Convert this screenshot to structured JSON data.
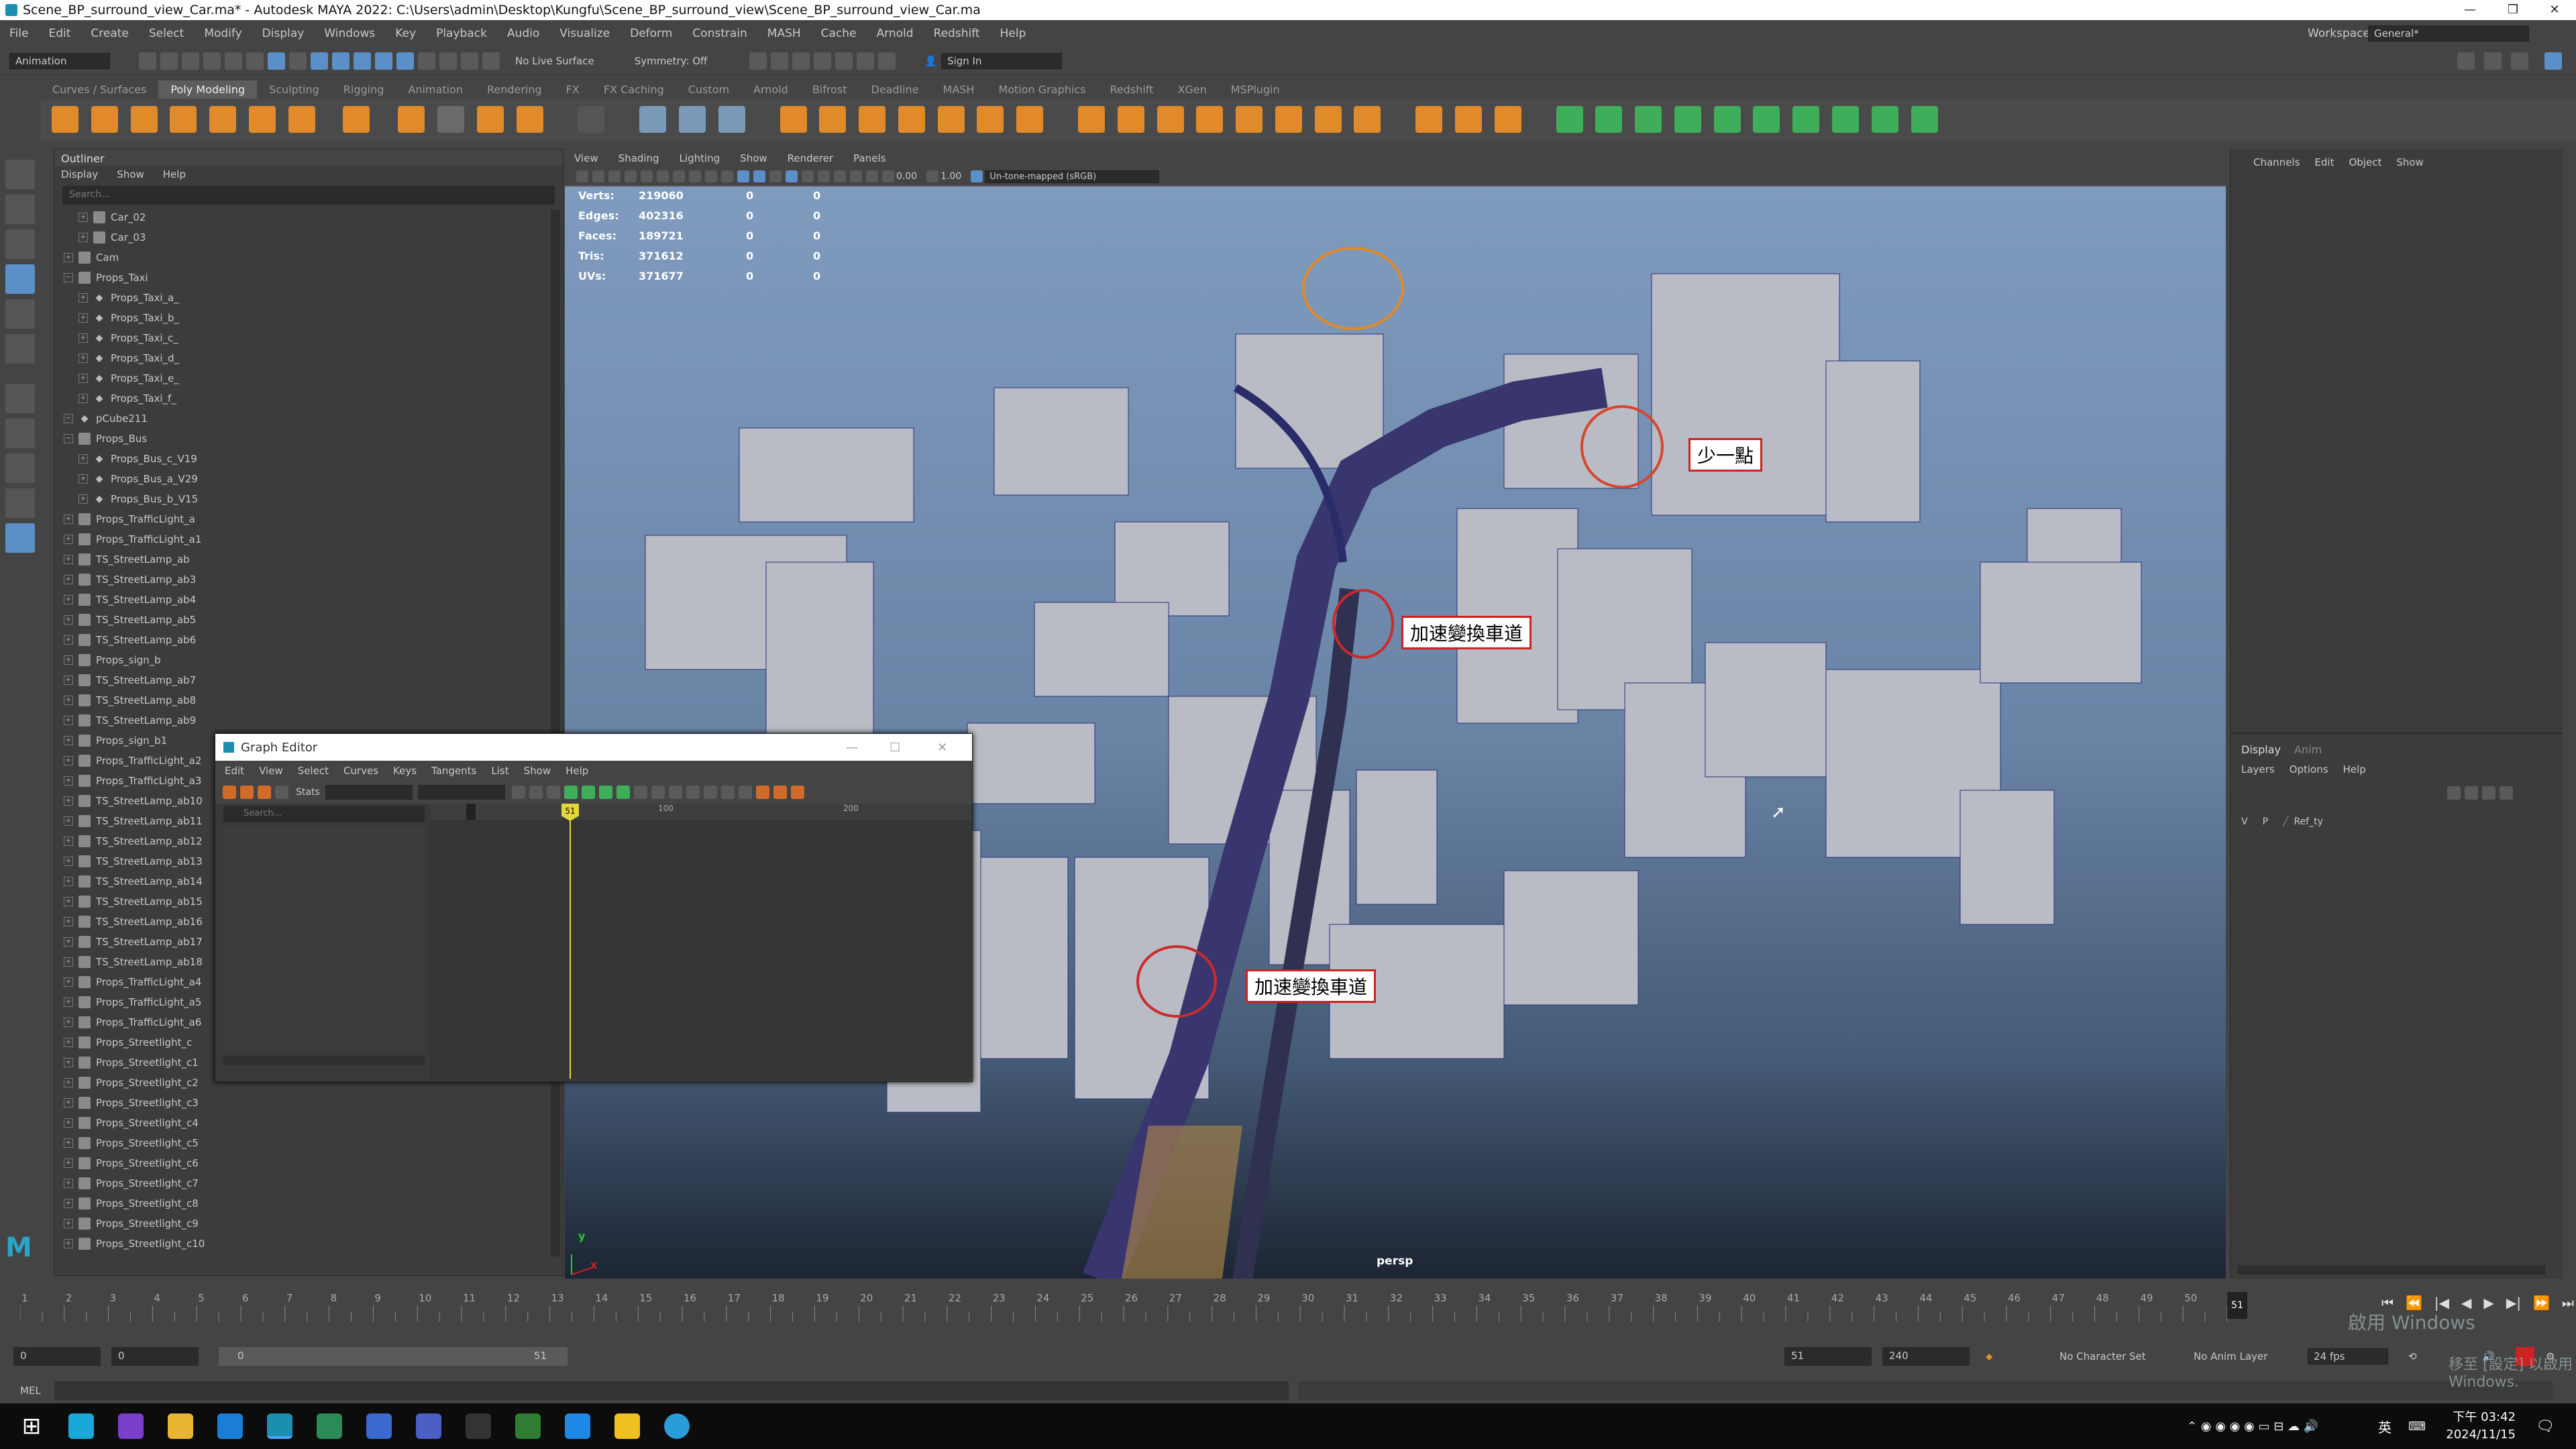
{
  "window": {
    "title": "Scene_BP_surround_view_Car.ma* - Autodesk MAYA 2022: C:\\Users\\admin\\Desktop\\Kungfu\\Scene_BP_surround_view\\Scene_BP_surround_view_Car.ma",
    "minimize": "—",
    "restore": "❐",
    "close": "✕"
  },
  "menubar": {
    "items": [
      "File",
      "Edit",
      "Create",
      "Select",
      "Modify",
      "Display",
      "Windows",
      "Key",
      "Playback",
      "Audio",
      "Visualize",
      "Deform",
      "Constrain",
      "MASH",
      "Cache",
      "Arnold",
      "Redshift",
      "Help"
    ],
    "workspace_label": "Workspace :",
    "workspace_value": "General*"
  },
  "statusline": {
    "menuset": "Animation",
    "live_surface": "No Live Surface",
    "symmetry": "Symmetry: Off",
    "sign_in": "Sign In"
  },
  "shelf": {
    "tabs": [
      "Curves / Surfaces",
      "Poly Modeling",
      "Sculpting",
      "Rigging",
      "Animation",
      "Rendering",
      "FX",
      "FX Caching",
      "Custom",
      "Arnold",
      "Bifrost",
      "Deadline",
      "MASH",
      "Motion Graphics",
      "Redshift",
      "XGen",
      "MSPlugin"
    ],
    "active_tab": "Poly Modeling"
  },
  "outliner": {
    "title": "Outliner",
    "menu": [
      "Display",
      "Show",
      "Help"
    ],
    "search_placeholder": "Search...",
    "items": [
      {
        "label": "Car_02",
        "indent": 1,
        "exp": true,
        "mesh": false
      },
      {
        "label": "Car_03",
        "indent": 1,
        "exp": true,
        "mesh": false
      },
      {
        "label": "Cam",
        "indent": 0,
        "exp": true,
        "mesh": false
      },
      {
        "label": "Props_Taxi",
        "indent": 0,
        "exp": false,
        "mesh": false
      },
      {
        "label": "Props_Taxi_a_",
        "indent": 1,
        "exp": true,
        "mesh": true
      },
      {
        "label": "Props_Taxi_b_",
        "indent": 1,
        "exp": true,
        "mesh": true
      },
      {
        "label": "Props_Taxi_c_",
        "indent": 1,
        "exp": true,
        "mesh": true
      },
      {
        "label": "Props_Taxi_d_",
        "indent": 1,
        "exp": true,
        "mesh": true
      },
      {
        "label": "Props_Taxi_e_",
        "indent": 1,
        "exp": true,
        "mesh": true
      },
      {
        "label": "Props_Taxi_f_",
        "indent": 1,
        "exp": true,
        "mesh": true
      },
      {
        "label": "pCube211",
        "indent": 0,
        "exp": false,
        "mesh": true
      },
      {
        "label": "Props_Bus",
        "indent": 0,
        "exp": false,
        "mesh": false
      },
      {
        "label": "Props_Bus_c_V19",
        "indent": 1,
        "exp": true,
        "mesh": true
      },
      {
        "label": "Props_Bus_a_V29",
        "indent": 1,
        "exp": true,
        "mesh": true
      },
      {
        "label": "Props_Bus_b_V15",
        "indent": 1,
        "exp": true,
        "mesh": true
      },
      {
        "label": "Props_TrafficLight_a",
        "indent": 0,
        "exp": true,
        "mesh": false
      },
      {
        "label": "Props_TrafficLight_a1",
        "indent": 0,
        "exp": true,
        "mesh": false
      },
      {
        "label": "TS_StreetLamp_ab",
        "indent": 0,
        "exp": true,
        "mesh": false
      },
      {
        "label": "TS_StreetLamp_ab3",
        "indent": 0,
        "exp": true,
        "mesh": false
      },
      {
        "label": "TS_StreetLamp_ab4",
        "indent": 0,
        "exp": true,
        "mesh": false
      },
      {
        "label": "TS_StreetLamp_ab5",
        "indent": 0,
        "exp": true,
        "mesh": false
      },
      {
        "label": "TS_StreetLamp_ab6",
        "indent": 0,
        "exp": true,
        "mesh": false
      },
      {
        "label": "Props_sign_b",
        "indent": 0,
        "exp": true,
        "mesh": false
      },
      {
        "label": "TS_StreetLamp_ab7",
        "indent": 0,
        "exp": true,
        "mesh": false
      },
      {
        "label": "TS_StreetLamp_ab8",
        "indent": 0,
        "exp": true,
        "mesh": false
      },
      {
        "label": "TS_StreetLamp_ab9",
        "indent": 0,
        "exp": true,
        "mesh": false
      },
      {
        "label": "Props_sign_b1",
        "indent": 0,
        "exp": true,
        "mesh": false
      },
      {
        "label": "Props_TrafficLight_a2",
        "indent": 0,
        "exp": true,
        "mesh": false
      },
      {
        "label": "Props_TrafficLight_a3",
        "indent": 0,
        "exp": true,
        "mesh": false
      },
      {
        "label": "TS_StreetLamp_ab10",
        "indent": 0,
        "exp": true,
        "mesh": false
      },
      {
        "label": "TS_StreetLamp_ab11",
        "indent": 0,
        "exp": true,
        "mesh": false
      },
      {
        "label": "TS_StreetLamp_ab12",
        "indent": 0,
        "exp": true,
        "mesh": false
      },
      {
        "label": "TS_StreetLamp_ab13",
        "indent": 0,
        "exp": true,
        "mesh": false
      },
      {
        "label": "TS_StreetLamp_ab14",
        "indent": 0,
        "exp": true,
        "mesh": false
      },
      {
        "label": "TS_StreetLamp_ab15",
        "indent": 0,
        "exp": true,
        "mesh": false
      },
      {
        "label": "TS_StreetLamp_ab16",
        "indent": 0,
        "exp": true,
        "mesh": false
      },
      {
        "label": "TS_StreetLamp_ab17",
        "indent": 0,
        "exp": true,
        "mesh": false
      },
      {
        "label": "TS_StreetLamp_ab18",
        "indent": 0,
        "exp": true,
        "mesh": false
      },
      {
        "label": "Props_TrafficLight_a4",
        "indent": 0,
        "exp": true,
        "mesh": false
      },
      {
        "label": "Props_TrafficLight_a5",
        "indent": 0,
        "exp": true,
        "mesh": false
      },
      {
        "label": "Props_TrafficLight_a6",
        "indent": 0,
        "exp": true,
        "mesh": false
      },
      {
        "label": "Props_Streetlight_c",
        "indent": 0,
        "exp": true,
        "mesh": false
      },
      {
        "label": "Props_Streetlight_c1",
        "indent": 0,
        "exp": true,
        "mesh": false
      },
      {
        "label": "Props_Streetlight_c2",
        "indent": 0,
        "exp": true,
        "mesh": false
      },
      {
        "label": "Props_Streetlight_c3",
        "indent": 0,
        "exp": true,
        "mesh": false
      },
      {
        "label": "Props_Streetlight_c4",
        "indent": 0,
        "exp": true,
        "mesh": false
      },
      {
        "label": "Props_Streetlight_c5",
        "indent": 0,
        "exp": true,
        "mesh": false
      },
      {
        "label": "Props_Streetlight_c6",
        "indent": 0,
        "exp": true,
        "mesh": false
      },
      {
        "label": "Props_Streetlight_c7",
        "indent": 0,
        "exp": true,
        "mesh": false
      },
      {
        "label": "Props_Streetlight_c8",
        "indent": 0,
        "exp": true,
        "mesh": false
      },
      {
        "label": "Props_Streetlight_c9",
        "indent": 0,
        "exp": true,
        "mesh": false
      },
      {
        "label": "Props_Streetlight_c10",
        "indent": 0,
        "exp": true,
        "mesh": false
      }
    ]
  },
  "graph_editor": {
    "title": "Graph Editor",
    "menu": [
      "Edit",
      "View",
      "Select",
      "Curves",
      "Keys",
      "Tangents",
      "List",
      "Show",
      "Help"
    ],
    "stats_label": "Stats",
    "search_placeholder": "Search...",
    "ruler": [
      "0",
      "100",
      "200"
    ],
    "current_frame": "51"
  },
  "viewport": {
    "menu": [
      "View",
      "Shading",
      "Lighting",
      "Show",
      "Renderer",
      "Panels"
    ],
    "exposure": "0.00",
    "gamma": "1.00",
    "colorspace": "Un-tone-mapped (sRGB)",
    "camera_label": "persp",
    "hud": [
      {
        "label": "Verts:",
        "value": "219060",
        "c1": "0",
        "c2": "0"
      },
      {
        "label": "Edges:",
        "value": "402316",
        "c1": "0",
        "c2": "0"
      },
      {
        "label": "Faces:",
        "value": "189721",
        "c1": "0",
        "c2": "0"
      },
      {
        "label": "Tris:",
        "value": "371612",
        "c1": "0",
        "c2": "0"
      },
      {
        "label": "UVs:",
        "value": "371677",
        "c1": "0",
        "c2": "0"
      }
    ],
    "annotations": [
      "少一點",
      "加速變換車道",
      "加速變換車道"
    ],
    "axis_y": "y",
    "axis_x": "x"
  },
  "channel_box": {
    "menu": [
      "Channels",
      "Edit",
      "Object",
      "Show"
    ],
    "tabs": [
      "Display",
      "Anim"
    ],
    "layer_menu": [
      "Layers",
      "Options",
      "Help"
    ],
    "layer": {
      "v": "V",
      "p": "P",
      "name": "Ref_ty"
    }
  },
  "timeline": {
    "ticks": [
      "1",
      "2",
      "3",
      "4",
      "5",
      "6",
      "7",
      "8",
      "9",
      "10",
      "11",
      "12",
      "13",
      "14",
      "15",
      "16",
      "17",
      "18",
      "19",
      "20",
      "21",
      "22",
      "23",
      "24",
      "25",
      "26",
      "27",
      "28",
      "29",
      "30",
      "31",
      "32",
      "33",
      "34",
      "35",
      "36",
      "37",
      "38",
      "39",
      "40",
      "41",
      "42",
      "43",
      "44",
      "45",
      "46",
      "47",
      "48",
      "49",
      "50"
    ],
    "current": "51"
  },
  "range": {
    "start": "0",
    "anim_start": "0",
    "slider_min": "0",
    "slider_max": "51",
    "end": "51",
    "anim_end": "240",
    "character_set": "No Character Set",
    "anim_layer": "No Anim Layer",
    "fps": "24 fps"
  },
  "mel": {
    "label": "MEL"
  },
  "watermark": {
    "line1": "啟用 Windows",
    "line2": "移至 [設定] 以啟用 Windows."
  },
  "taskbar": {
    "time": "下午 03:42",
    "date": "2024/11/15",
    "lang": "英"
  }
}
